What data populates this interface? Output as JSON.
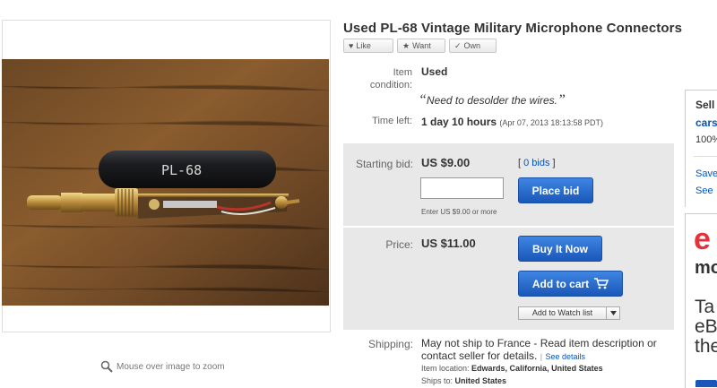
{
  "listing": {
    "title": "Used PL-68 Vintage Military Microphone Connectors",
    "image_label": "PL-68",
    "zoom_hint": "Mouse over image to zoom"
  },
  "social": {
    "like": "Like",
    "want": "Want",
    "own": "Own"
  },
  "details": {
    "condition_label": "Item condition:",
    "condition_label_1": "Item",
    "condition_label_2": "condition:",
    "condition_value": "Used",
    "condition_note": "Need to desolder the wires.",
    "time_label": "Time left:",
    "time_value": "1 day 10 hours",
    "time_detail": "(Apr 07, 2013  18:13:58 PDT)"
  },
  "bid": {
    "label": "Starting bid:",
    "amount": "US $9.00",
    "bids": "0 bids",
    "input_value": "",
    "place_bid": "Place bid",
    "hint": "Enter US $9.00 or more"
  },
  "buy": {
    "label": "Price:",
    "amount": "US $11.00",
    "buy_now": "Buy It Now",
    "add_to_cart": "Add to cart",
    "watch": "Add to Watch list"
  },
  "shipping": {
    "label": "Shipping:",
    "text": "May not ship to France - Read item description or contact seller for details.",
    "text_1": "May not ship to France - Read item description or",
    "text_2": "contact seller for details.",
    "see_details": "See details",
    "location_label": "Item location:",
    "location": "Edwards, California, United States",
    "ships_label": "Ships to:",
    "ships": "United States"
  },
  "sidebar": {
    "seller_heading": "Sell",
    "seller_name": "cars",
    "feedback": "100%",
    "save": "Save",
    "see": "See",
    "ad_e": "e",
    "ad_mo": "mo",
    "ad_l1": "Ta",
    "ad_l2": "eB",
    "ad_l3": "the"
  },
  "colors": {
    "link": "#0654ba",
    "button_blue": "#1a57b8",
    "panel_gray": "#e8e8e8",
    "ad_red": "#e53238"
  }
}
